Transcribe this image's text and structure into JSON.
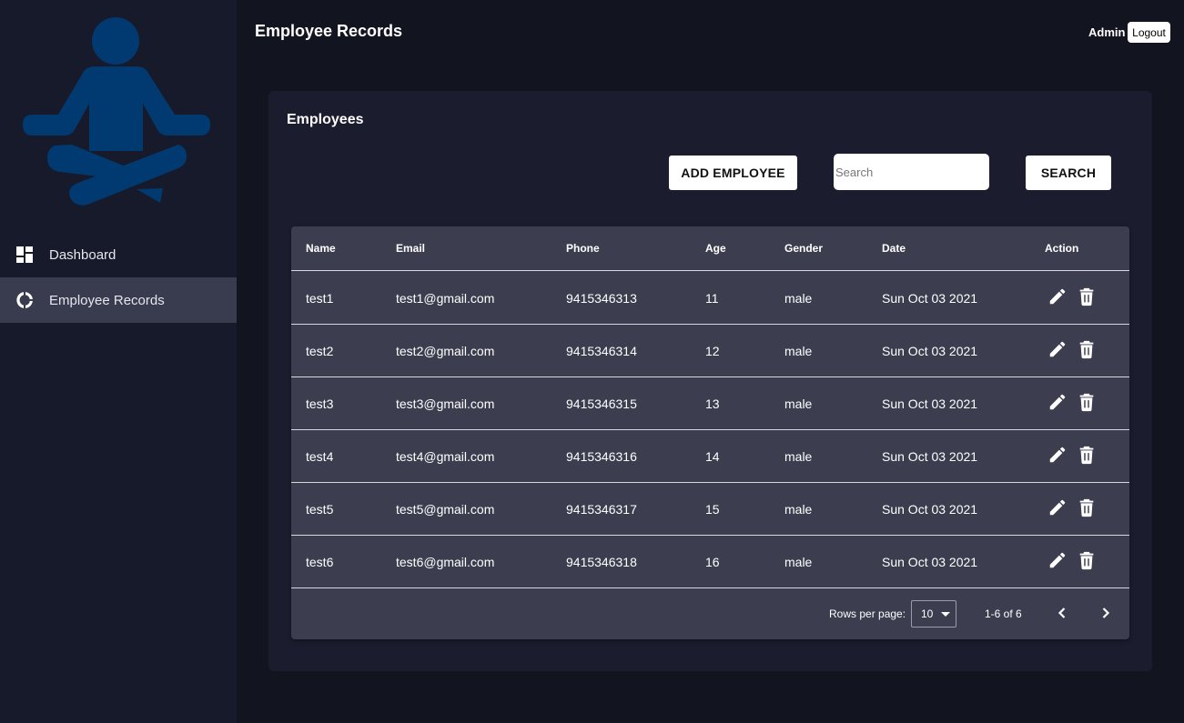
{
  "header": {
    "title": "Employee Records",
    "user": "Admin",
    "logout_label": "Logout"
  },
  "sidebar": {
    "logo_icon": "meditation-person-icon",
    "logo_color": "#003a70",
    "items": [
      {
        "label": "Dashboard",
        "icon": "dashboard-icon",
        "active": false
      },
      {
        "label": "Employee Records",
        "icon": "donut-chart-icon",
        "active": true
      }
    ]
  },
  "panel": {
    "title": "Employees",
    "add_label": "ADD EMPLOYEE",
    "search_placeholder": "Search",
    "search_value": "",
    "search_label": "SEARCH"
  },
  "table": {
    "columns": [
      "Name",
      "Email",
      "Phone",
      "Age",
      "Gender",
      "Date",
      "Action"
    ],
    "rows": [
      {
        "name": "test1",
        "email": "test1@gmail.com",
        "phone": "9415346313",
        "age": "11",
        "gender": "male",
        "date": "Sun Oct 03 2021"
      },
      {
        "name": "test2",
        "email": "test2@gmail.com",
        "phone": "9415346314",
        "age": "12",
        "gender": "male",
        "date": "Sun Oct 03 2021"
      },
      {
        "name": "test3",
        "email": "test3@gmail.com",
        "phone": "9415346315",
        "age": "13",
        "gender": "male",
        "date": "Sun Oct 03 2021"
      },
      {
        "name": "test4",
        "email": "test4@gmail.com",
        "phone": "9415346316",
        "age": "14",
        "gender": "male",
        "date": "Sun Oct 03 2021"
      },
      {
        "name": "test5",
        "email": "test5@gmail.com",
        "phone": "9415346317",
        "age": "15",
        "gender": "male",
        "date": "Sun Oct 03 2021"
      },
      {
        "name": "test6",
        "email": "test6@gmail.com",
        "phone": "9415346318",
        "age": "16",
        "gender": "male",
        "date": "Sun Oct 03 2021"
      }
    ]
  },
  "pagination": {
    "rows_per_page_label": "Rows per page:",
    "rows_per_page": "10",
    "range": "1-6 of 6"
  },
  "colors": {
    "background": "#121420",
    "sidebar": "#171a2b",
    "panel": "#1b1d2e",
    "table": "#3c3e50",
    "active_nav": "#393b4e"
  }
}
